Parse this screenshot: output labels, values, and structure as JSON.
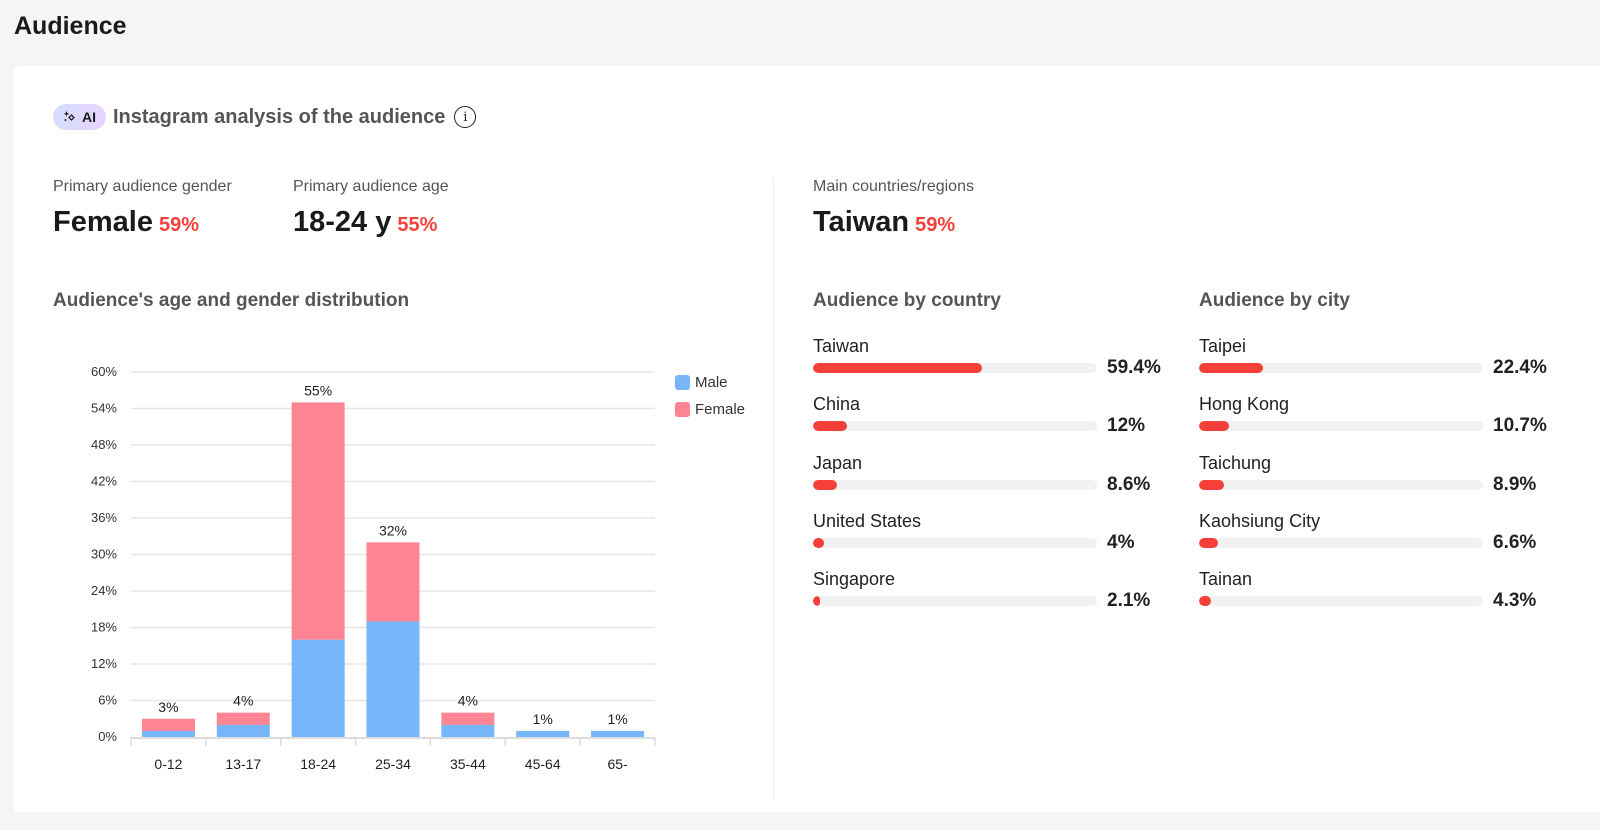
{
  "page": {
    "title": "Audience"
  },
  "header": {
    "ai_badge": "AI",
    "ai_icon": "sparkle-icon",
    "title": "Instagram analysis of the audience",
    "info_icon": "info-icon",
    "info_glyph": "i"
  },
  "stats": {
    "gender": {
      "label": "Primary audience gender",
      "value": "Female",
      "pct": "59%"
    },
    "age": {
      "label": "Primary audience age",
      "value": "18-24 y",
      "pct": "55%"
    },
    "country": {
      "label": "Main countries/regions",
      "value": "Taiwan",
      "pct": "59%"
    }
  },
  "sections": {
    "age_gender": "Audience's age and gender distribution",
    "by_country": "Audience by country",
    "by_city": "Audience by city"
  },
  "colors": {
    "male": "#76b6f9",
    "female": "#fe8494",
    "accent": "#f5403a"
  },
  "chart_data": {
    "type": "bar",
    "stacked": true,
    "title": "Audience's age and gender distribution",
    "xlabel": "",
    "ylabel": "",
    "categories": [
      "0-12",
      "13-17",
      "18-24",
      "25-34",
      "35-44",
      "45-64",
      "65-"
    ],
    "series": [
      {
        "name": "Male",
        "values": [
          1,
          2,
          16,
          19,
          2,
          1,
          1
        ]
      },
      {
        "name": "Female",
        "values": [
          2,
          2,
          39,
          13,
          2,
          0,
          0
        ]
      }
    ],
    "totals_labels": [
      "3%",
      "4%",
      "55%",
      "32%",
      "4%",
      "1%",
      "1%"
    ],
    "totals": [
      3,
      4,
      55,
      32,
      4,
      1,
      1
    ],
    "ylim": [
      0,
      60
    ],
    "yticks": [
      0,
      6,
      12,
      18,
      24,
      30,
      36,
      42,
      48,
      54,
      60
    ],
    "ytick_labels": [
      "0%",
      "6%",
      "12%",
      "18%",
      "24%",
      "30%",
      "36%",
      "42%",
      "48%",
      "54%",
      "60%"
    ],
    "grid": true,
    "legend": {
      "position": "right",
      "entries": [
        "Male",
        "Female"
      ]
    }
  },
  "countries": [
    {
      "name": "Taiwan",
      "value": "59.4%",
      "pct": 59.4
    },
    {
      "name": "China",
      "value": "12%",
      "pct": 12
    },
    {
      "name": "Japan",
      "value": "8.6%",
      "pct": 8.6
    },
    {
      "name": "United States",
      "value": "4%",
      "pct": 4
    },
    {
      "name": "Singapore",
      "value": "2.1%",
      "pct": 2.1
    }
  ],
  "cities": [
    {
      "name": "Taipei",
      "value": "22.4%",
      "pct": 22.4
    },
    {
      "name": "Hong Kong",
      "value": "10.7%",
      "pct": 10.7
    },
    {
      "name": "Taichung",
      "value": "8.9%",
      "pct": 8.9
    },
    {
      "name": "Kaohsiung City",
      "value": "6.6%",
      "pct": 6.6
    },
    {
      "name": "Tainan",
      "value": "4.3%",
      "pct": 4.3
    }
  ]
}
